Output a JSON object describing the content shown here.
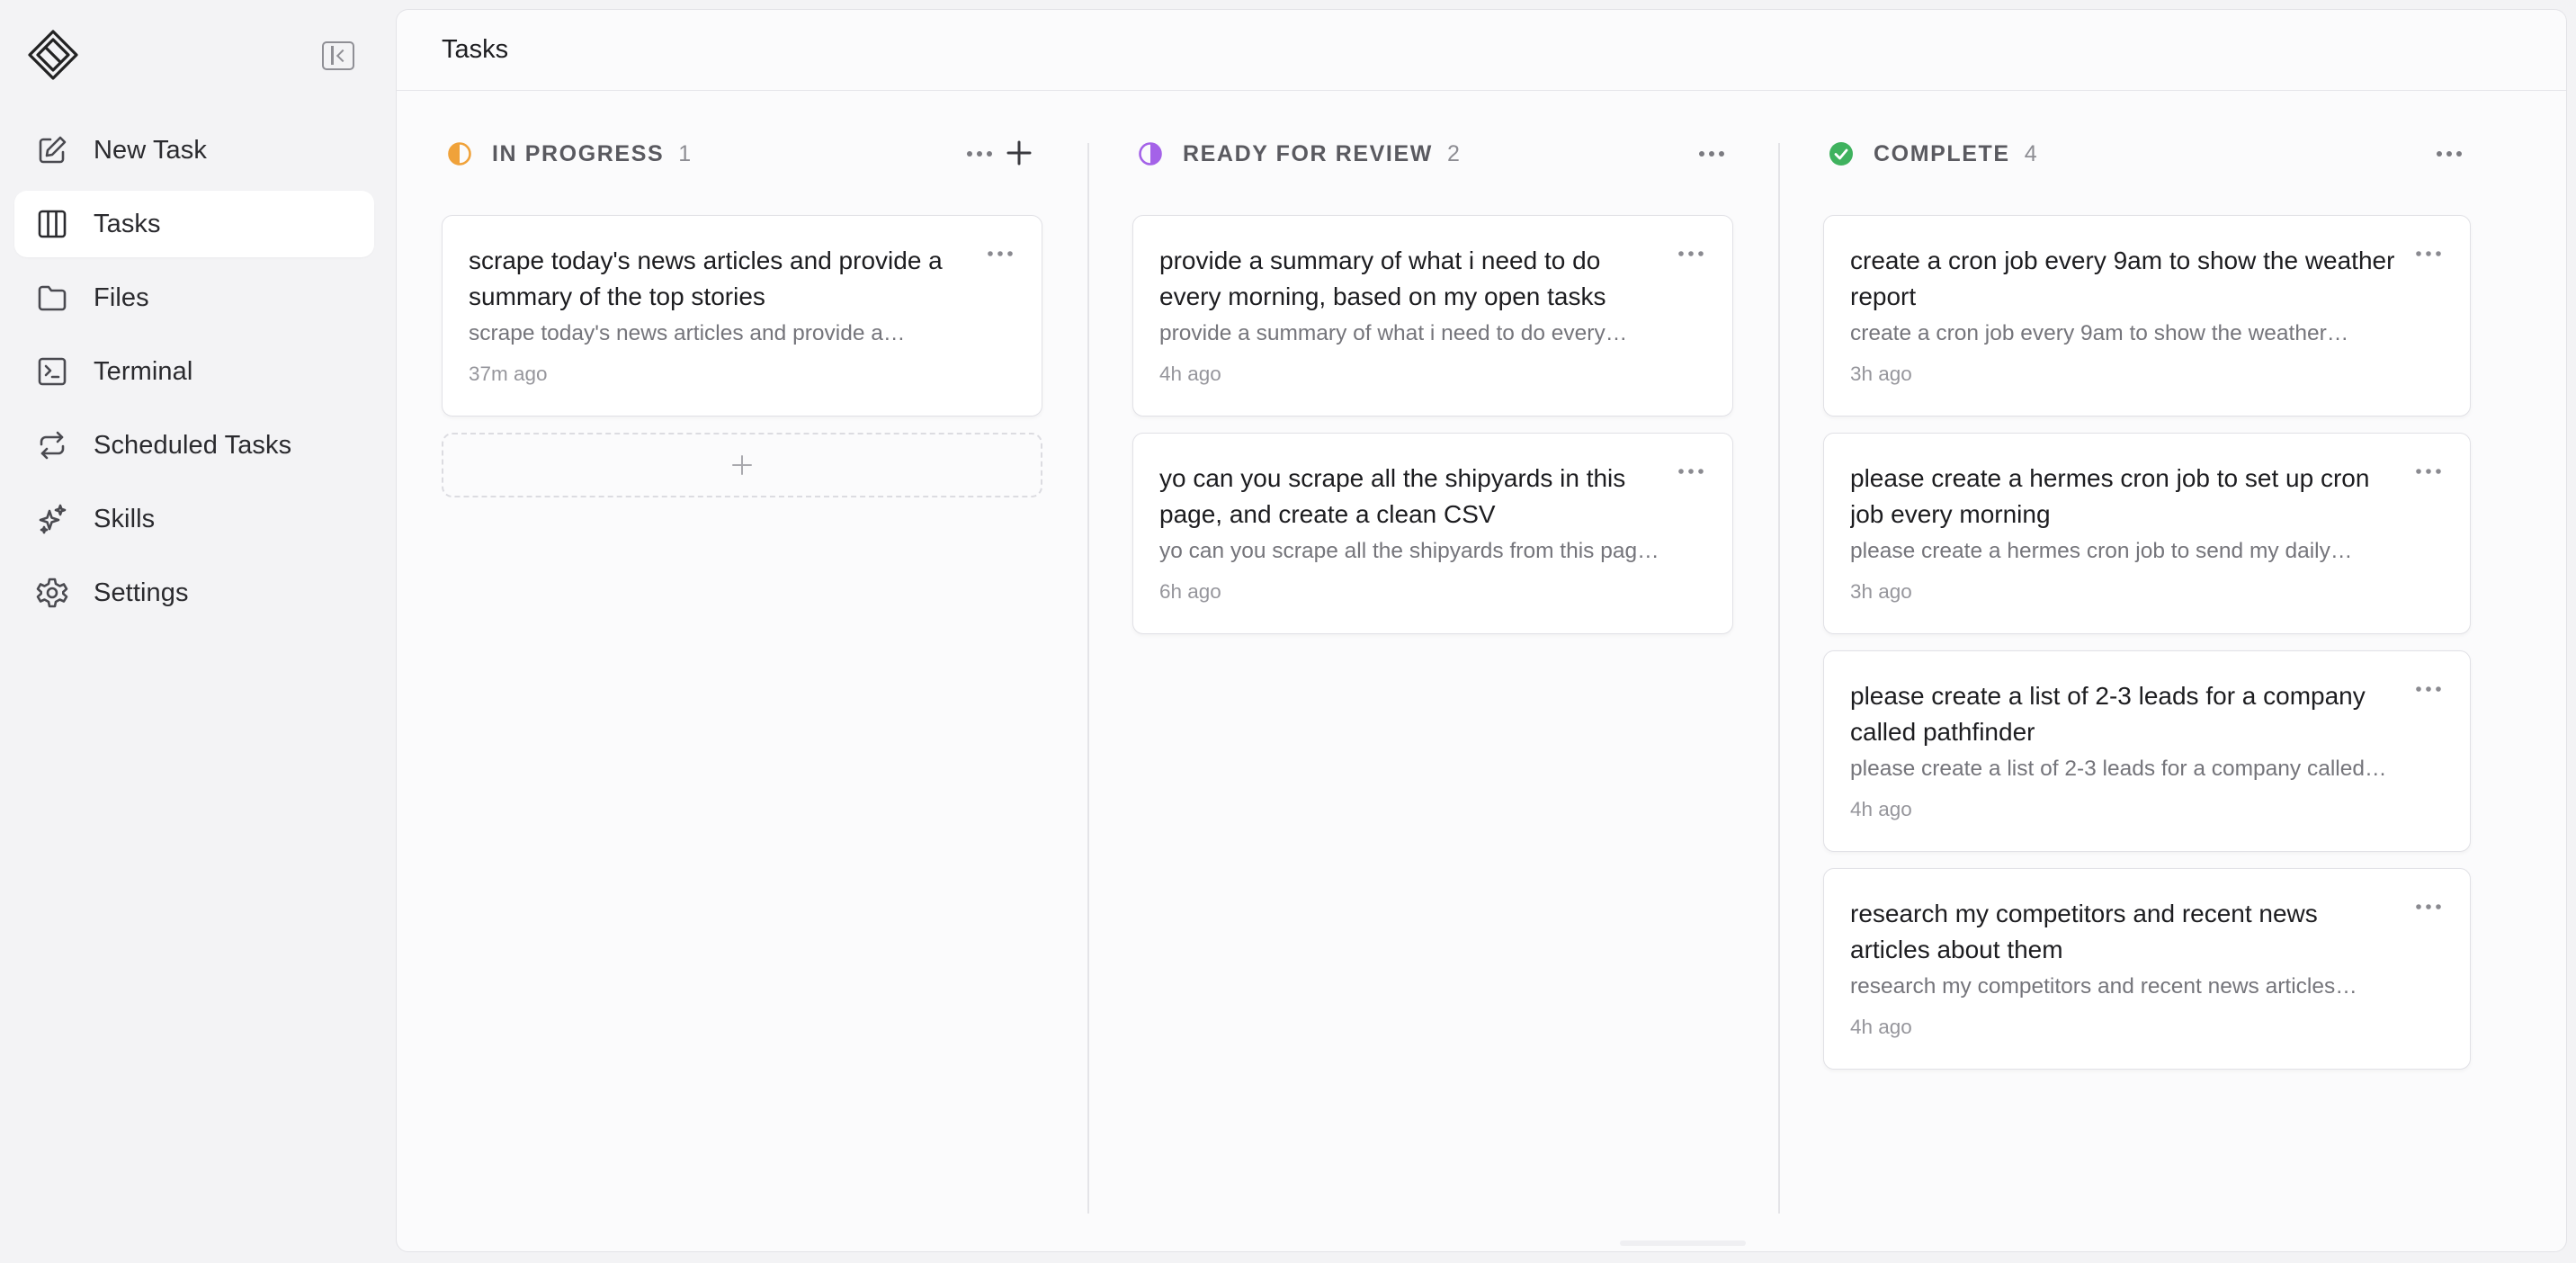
{
  "sidebar": {
    "logo": "diamond-logo",
    "collapse_icon": "sidebar-collapse-icon",
    "items": [
      {
        "label": "New Task",
        "icon": "edit-icon",
        "active": false
      },
      {
        "label": "Tasks",
        "icon": "columns-icon",
        "active": true
      },
      {
        "label": "Files",
        "icon": "folder-icon",
        "active": false
      },
      {
        "label": "Terminal",
        "icon": "terminal-icon",
        "active": false
      },
      {
        "label": "Scheduled Tasks",
        "icon": "repeat-icon",
        "active": false
      },
      {
        "label": "Skills",
        "icon": "sparkles-icon",
        "active": false
      },
      {
        "label": "Settings",
        "icon": "gear-icon",
        "active": false
      }
    ]
  },
  "header": {
    "title": "Tasks"
  },
  "columns": [
    {
      "title": "IN PROGRESS",
      "count": "1",
      "status_color": "#f0a23a",
      "cards": [
        {
          "title": "scrape today's news articles and provide a summary of the top stories",
          "desc": "scrape today's news articles and provide a…",
          "time": "37m ago"
        }
      ]
    },
    {
      "title": "READY FOR REVIEW",
      "count": "2",
      "status_color": "#a462e8",
      "cards": [
        {
          "title": "provide a summary of what i need to do every morning, based on my open tasks",
          "desc": "provide a summary of what i need to do every…",
          "time": "4h ago"
        },
        {
          "title": "yo can you scrape all the shipyards in this page, and create a clean CSV",
          "desc": "yo can you scrape all the shipyards from this pag…",
          "time": "6h ago"
        }
      ]
    },
    {
      "title": "COMPLETE",
      "count": "4",
      "status_color": "#3fb25e",
      "cards": [
        {
          "title": "create a cron job every 9am to show the weather report",
          "desc": "create a cron job every 9am to show the weather…",
          "time": "3h ago"
        },
        {
          "title": "please create a hermes cron job to set up cron job every morning",
          "desc": "please create a hermes cron job to send my daily…",
          "time": "3h ago"
        },
        {
          "title": "please create a list of 2-3 leads for a company called pathfinder",
          "desc": "please create a list of 2-3 leads for a company called…",
          "time": "4h ago"
        },
        {
          "title": "research my competitors and recent news articles about them",
          "desc": "research my competitors and recent news articles…",
          "time": "4h ago"
        }
      ]
    }
  ]
}
